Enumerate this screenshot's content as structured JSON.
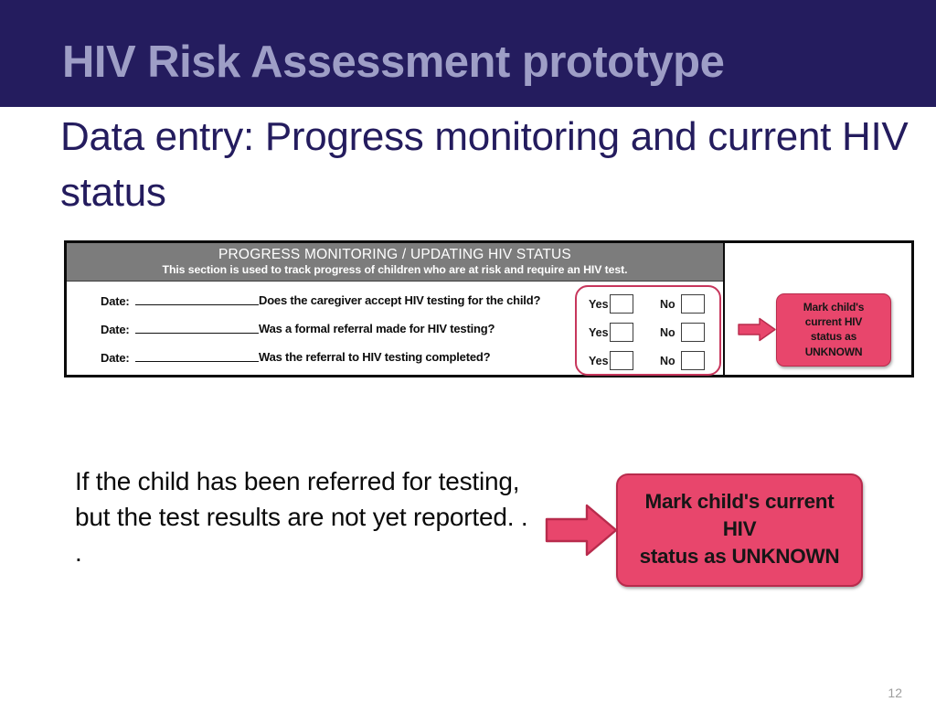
{
  "slide": {
    "title": "HIV Risk Assessment prototype",
    "subtitle": "Data entry: Progress monitoring and current HIV status",
    "page_number": "12"
  },
  "colors": {
    "title_bar_bg": "#241c5e",
    "title_text": "#9e9ec6",
    "subtitle_text": "#241c5e",
    "form_header_bg": "#7c7c7c",
    "accent_pink": "#e8466c",
    "accent_pink_border": "#b82b4c",
    "highlight_ring": "#c7365c",
    "page_number_text": "#9d9d9d"
  },
  "form": {
    "header": {
      "title": "PROGRESS MONITORING / UPDATING HIV STATUS",
      "subtitle": "This section is used to track progress of children who are at risk and require an HIV test."
    },
    "rows": [
      {
        "date_label": "Date:",
        "date_value": "",
        "question": "Does the caregiver accept HIV testing for the child?",
        "yes_label": "Yes",
        "no_label": "No",
        "yes_checked": false,
        "no_checked": false
      },
      {
        "date_label": "Date:",
        "date_value": "",
        "question": "Was a formal referral made for HIV testing?",
        "yes_label": "Yes",
        "no_label": "No",
        "yes_checked": false,
        "no_checked": false
      },
      {
        "date_label": "Date:",
        "date_value": "",
        "question": "Was the referral to HIV testing completed?",
        "yes_label": "Yes",
        "no_label": "No",
        "yes_checked": false,
        "no_checked": false
      }
    ],
    "callout": {
      "line1": "Mark child's current HIV",
      "line2": "status as UNKNOWN"
    }
  },
  "explanation": {
    "text": "If the child has been referred for testing, but the test results are not yet reported. . .",
    "callout": {
      "line1": "Mark child's current HIV",
      "line2": "status as UNKNOWN"
    }
  }
}
